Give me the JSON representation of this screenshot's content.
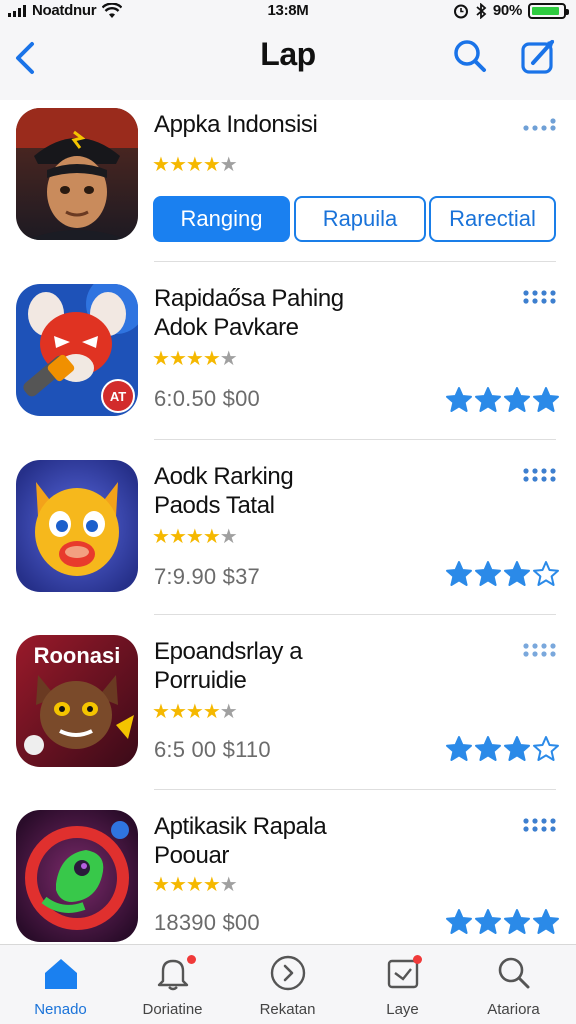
{
  "status_bar": {
    "carrier": "Noatdnur",
    "time": "13:8M",
    "battery": "90%",
    "battery_level": 0.9
  },
  "nav": {
    "title": "Lap"
  },
  "tabs": [
    "Ranging",
    "Rapuila",
    "Rarectial"
  ],
  "apps": [
    {
      "name_lines": [
        "Appka Indonsisi"
      ],
      "stars": 4,
      "price": "",
      "blue_stars": 0,
      "icon": "soldier-avatar-icon"
    },
    {
      "name_lines": [
        "Rapidaősa Pahing",
        "Adok Pavkare"
      ],
      "stars": 4,
      "price": "6:0.50  $00",
      "blue_stars": 4,
      "icon": "red-mouse-icon"
    },
    {
      "name_lines": [
        "Aodk Rarking",
        "Paods Tatal"
      ],
      "stars": 4,
      "price": "7:9.90  $37",
      "blue_stars": 3,
      "icon": "golden-cat-icon"
    },
    {
      "name_lines": [
        "Epoandsrlay a",
        "Porruidie"
      ],
      "stars": 4,
      "price": "6:5 00  $110",
      "blue_stars": 3,
      "icon": "brown-cat-icon"
    },
    {
      "name_lines": [
        "Aptikasik Rapala",
        "Poouar"
      ],
      "stars": 4,
      "price": "18390  $00",
      "blue_stars": 4,
      "icon": "green-creature-icon"
    }
  ],
  "app_overlays": {
    "app3_icon_text": "Roonasi",
    "app2_badge": "AT"
  },
  "tab_bar": [
    {
      "label": "Nenado",
      "icon": "home-icon",
      "active": true
    },
    {
      "label": "Doriatine",
      "icon": "bell-icon",
      "active": false
    },
    {
      "label": "Rekatan",
      "icon": "compass-icon",
      "active": false
    },
    {
      "label": "Laye",
      "icon": "inbox-icon",
      "active": false
    },
    {
      "label": "Atariora",
      "icon": "search-icon",
      "active": false
    }
  ],
  "colors": {
    "accent": "#1a80f0",
    "star_gold": "#f5b800",
    "star_blue": "#2b8ae8",
    "badge_red": "#f03a3a"
  }
}
